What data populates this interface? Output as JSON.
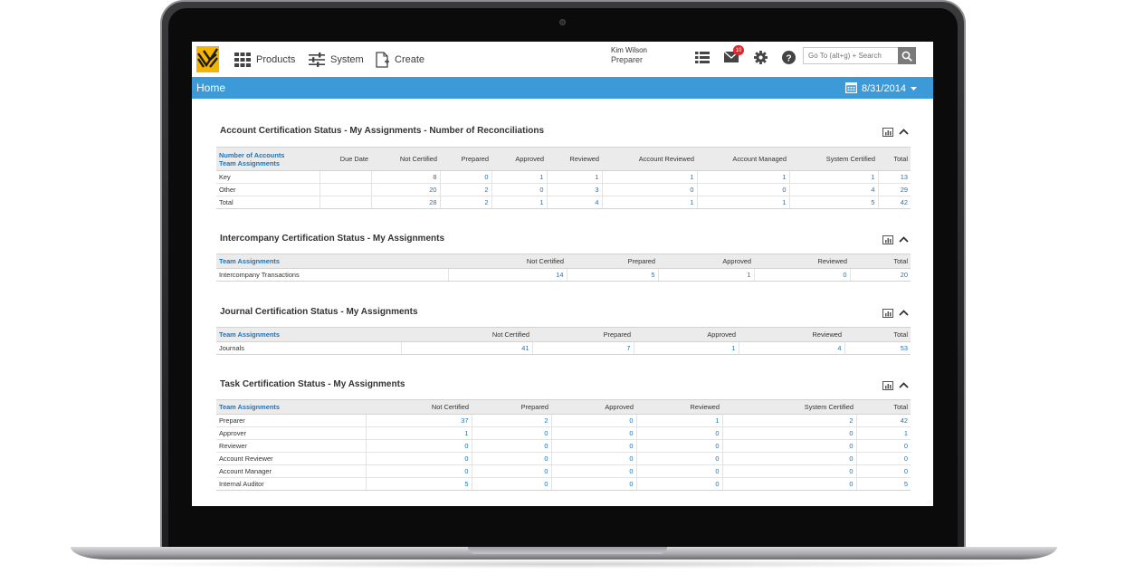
{
  "topbar": {
    "nav": {
      "products": "Products",
      "system": "System",
      "create": "Create"
    },
    "user": {
      "name": "Kim Wilson",
      "role": "Preparer"
    },
    "mail_count": "10",
    "search_placeholder": "Go To (alt+g) + Search"
  },
  "homebar": {
    "title": "Home",
    "date": "8/31/2014"
  },
  "colors": {
    "brand": "#f5b400",
    "accent": "#3d9ad8",
    "link": "#1f73b7",
    "badge": "#e3242b"
  },
  "sections": {
    "account": {
      "title": "Account Certification Status - My Assignments - Number of Reconciliations",
      "header_first_line1": "Number of Accounts",
      "header_first_line2": "Team Assignments",
      "columns": [
        "Due Date",
        "Not Certified",
        "Prepared",
        "Approved",
        "Reviewed",
        "Account Reviewed",
        "Account Managed",
        "System Certified",
        "Total"
      ],
      "rows": [
        {
          "label": "Key",
          "values": [
            "",
            "8",
            "0",
            "1",
            "1",
            "1",
            "1",
            "1",
            "13"
          ]
        },
        {
          "label": "Other",
          "values": [
            "",
            "20",
            "2",
            "0",
            "3",
            "0",
            "0",
            "4",
            "29"
          ]
        },
        {
          "label": "Total",
          "values": [
            "",
            "28",
            "2",
            "1",
            "4",
            "1",
            "1",
            "5",
            "42"
          ]
        }
      ]
    },
    "intercompany": {
      "title": "Intercompany Certification Status - My Assignments",
      "header_first": "Team Assignments",
      "columns": [
        "Not Certified",
        "Prepared",
        "Approved",
        "Reviewed",
        "Total"
      ],
      "rows": [
        {
          "label": "Intercompany Transactions",
          "values": [
            "14",
            "5",
            "1",
            "0",
            "20"
          ]
        }
      ]
    },
    "journal": {
      "title": "Journal Certification Status - My Assignments",
      "header_first": "Team Assignments",
      "columns": [
        "Not Certified",
        "Prepared",
        "Approved",
        "Reviewed",
        "Total"
      ],
      "rows": [
        {
          "label": "Journals",
          "values": [
            "41",
            "7",
            "1",
            "4",
            "53"
          ]
        }
      ]
    },
    "task": {
      "title": "Task Certification Status - My Assignments",
      "header_first": "Team Assignments",
      "columns": [
        "Not Certified",
        "Prepared",
        "Approved",
        "Reviewed",
        "System Certified",
        "Total"
      ],
      "rows": [
        {
          "label": "Preparer",
          "values": [
            "37",
            "2",
            "0",
            "1",
            "2",
            "42"
          ]
        },
        {
          "label": "Approver",
          "values": [
            "1",
            "0",
            "0",
            "0",
            "0",
            "1"
          ]
        },
        {
          "label": "Reviewer",
          "values": [
            "0",
            "0",
            "0",
            "0",
            "0",
            "0"
          ]
        },
        {
          "label": "Account Reviewer",
          "values": [
            "0",
            "0",
            "0",
            "0",
            "0",
            "0"
          ]
        },
        {
          "label": "Account Manager",
          "values": [
            "0",
            "0",
            "0",
            "0",
            "0",
            "0"
          ]
        },
        {
          "label": "Internal Auditor",
          "values": [
            "5",
            "0",
            "0",
            "0",
            "0",
            "5"
          ]
        }
      ]
    }
  }
}
